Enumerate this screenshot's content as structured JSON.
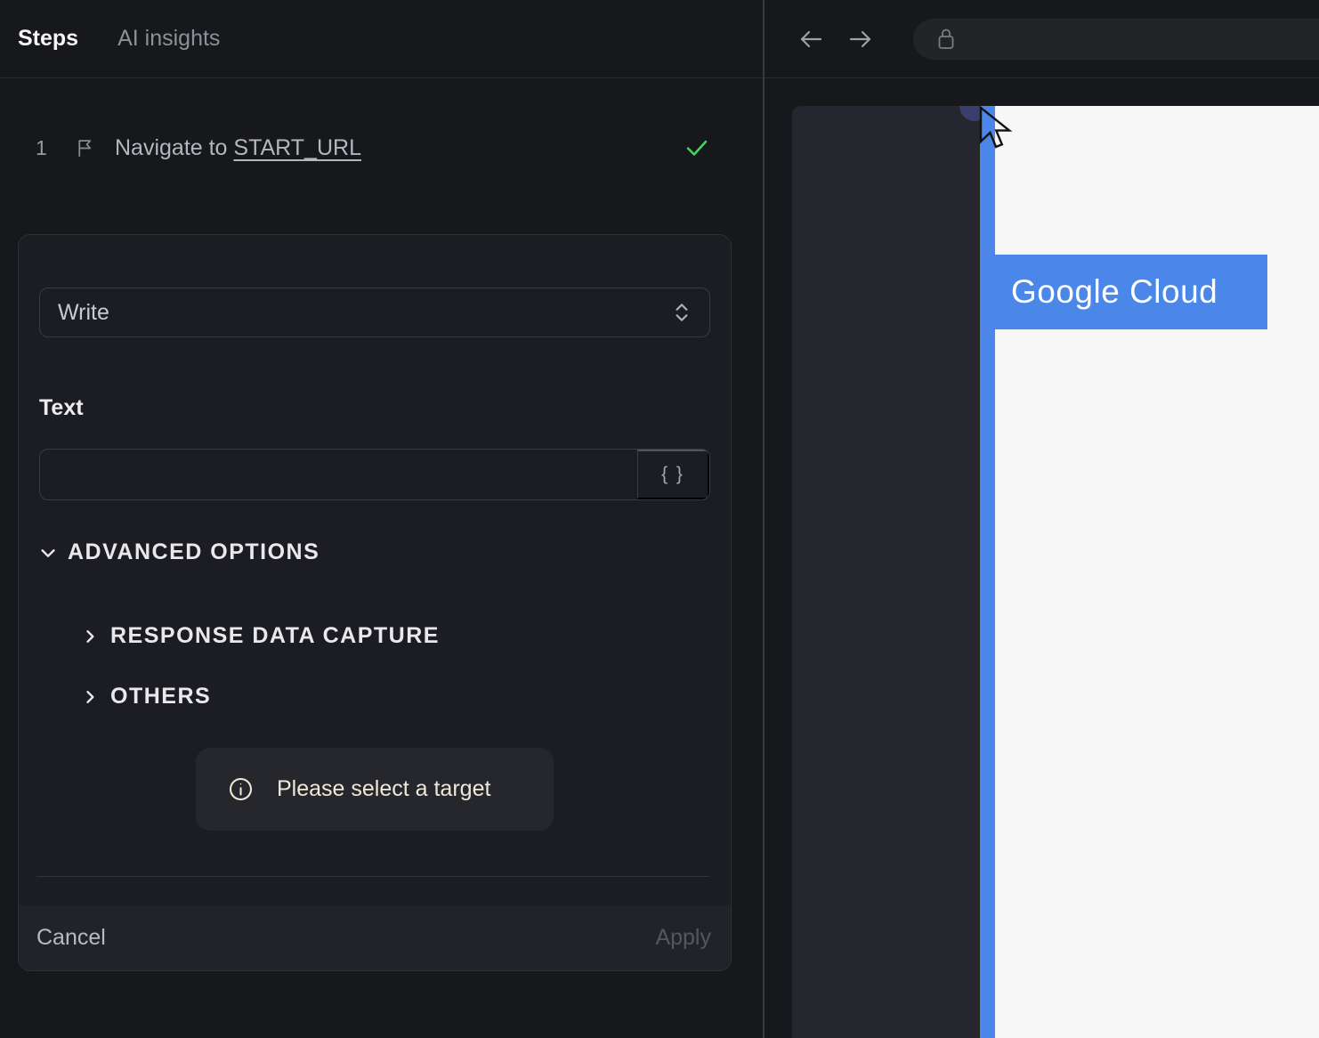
{
  "tabs": {
    "steps": "Steps",
    "ai_insights": "AI insights"
  },
  "step": {
    "index": "1",
    "action": "Navigate to ",
    "target": "START_URL",
    "status_icon": "check-success"
  },
  "editor": {
    "command": "Write",
    "text_label": "Text",
    "text_value": "",
    "braces_button": "{ }",
    "advanced_header": "ADVANCED OPTIONS",
    "sections": {
      "response_data_capture": "RESPONSE DATA CAPTURE",
      "others": "OTHERS"
    },
    "notice": "Please select a target",
    "cancel_label": "Cancel",
    "apply_label": "Apply"
  },
  "browser": {
    "url_value": "",
    "page_headline": "Google Cloud"
  },
  "colors": {
    "accent_blue": "#4a87e9",
    "success_green": "#3fd95a",
    "notice_text": "#efe8d8",
    "panel_bg": "#17181c",
    "card_bg": "#1c1d22",
    "page_dark": "#25262e",
    "page_white": "#f7f7f8"
  }
}
